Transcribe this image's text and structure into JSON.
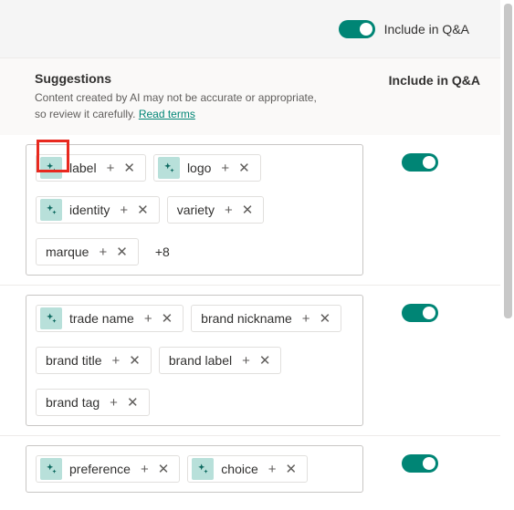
{
  "topBar": {
    "toggleLabel": "Include in Q&A"
  },
  "suggestions": {
    "title": "Suggestions",
    "desc_a": "Content created by AI may not be accurate or appropriate, so review it carefully. ",
    "readTerms": "Read terms",
    "includeHeader": "Include in Q&A"
  },
  "groups": [
    {
      "more": "+8",
      "chips": [
        {
          "label": "label",
          "ai": true
        },
        {
          "label": "logo",
          "ai": true
        },
        {
          "label": "identity",
          "ai": true
        },
        {
          "label": "variety",
          "ai": false
        },
        {
          "label": "marque",
          "ai": false
        }
      ]
    },
    {
      "more": null,
      "chips": [
        {
          "label": "trade name",
          "ai": true
        },
        {
          "label": "brand nickname",
          "ai": false
        },
        {
          "label": "brand title",
          "ai": false
        },
        {
          "label": "brand label",
          "ai": false
        },
        {
          "label": "brand tag",
          "ai": false
        }
      ]
    },
    {
      "more": null,
      "chips": [
        {
          "label": "preference",
          "ai": true
        },
        {
          "label": "choice",
          "ai": true
        }
      ]
    }
  ]
}
